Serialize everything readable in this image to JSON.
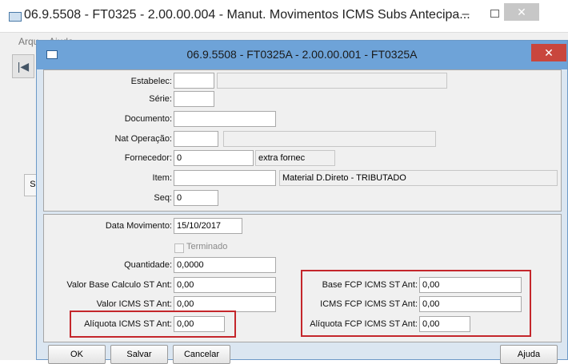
{
  "parent_window": {
    "title": "06.9.5508 - FT0325 - 2.00.00.004 - Manut. Movimentos ICMS Subs Antecipa...",
    "menu_partial": "Arqu...   Ajuda",
    "tab_partial": "Sa",
    "minimize_glyph": "–",
    "close_glyph": "✕"
  },
  "dialog": {
    "title": "06.9.5508 - FT0325A - 2.00.00.001 - FT0325A",
    "close_glyph": "✕",
    "fields": {
      "estabelec": {
        "label": "Estabelec:",
        "value": "",
        "desc": ""
      },
      "serie": {
        "label": "Série:",
        "value": ""
      },
      "documento": {
        "label": "Documento:",
        "value": ""
      },
      "nat_operacao": {
        "label": "Nat Operação:",
        "value": "",
        "desc": ""
      },
      "fornecedor": {
        "label": "Fornecedor:",
        "value": "0",
        "desc": "extra fornec"
      },
      "item": {
        "label": "Item:",
        "value": "",
        "desc": "Material D.Direto - TRIBUTADO"
      },
      "seq": {
        "label": "Seq:",
        "value": "0"
      },
      "data_movimento": {
        "label": "Data Movimento:",
        "value": "15/10/2017"
      },
      "terminado": {
        "label": "Terminado",
        "checked": false
      },
      "quantidade": {
        "label": "Quantidade:",
        "value": "0,0000"
      },
      "valor_base_calculo_st_ant": {
        "label": "Valor Base Calculo ST Ant:",
        "value": "0,00"
      },
      "valor_icms_st_ant": {
        "label": "Valor ICMS ST Ant:",
        "value": "0,00"
      },
      "aliquota_icms_st_ant": {
        "label": "Alíquota ICMS ST Ant:",
        "value": "0,00"
      },
      "base_fcp_icms_st_ant": {
        "label": "Base FCP ICMS ST Ant:",
        "value": "0,00"
      },
      "icms_fcp_icms_st_ant": {
        "label": "ICMS FCP ICMS ST Ant:",
        "value": "0,00"
      },
      "aliquota_fcp_icms_st_ant": {
        "label": "Alíquota FCP ICMS ST Ant:",
        "value": "0,00"
      }
    },
    "buttons": {
      "ok": "OK",
      "salvar": "Salvar",
      "cancelar": "Cancelar",
      "ajuda": "Ajuda"
    },
    "highlight_color": "#c4262b"
  }
}
